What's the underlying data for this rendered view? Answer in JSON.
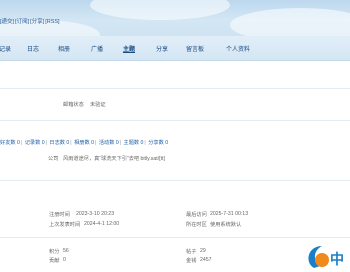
{
  "header": {
    "links": [
      "[递交]",
      "[订阅]",
      "[分享]",
      "[RSS]"
    ],
    "links_prefix": "递交"
  },
  "nav": {
    "items": [
      "记录",
      "日志",
      "相册",
      "广播",
      "主题",
      "分享",
      "留言板",
      "个人资料"
    ],
    "active_index": 4
  },
  "profile": {
    "email_status_label": "邮箱状态",
    "email_status_value": "未验证",
    "stats": [
      "好友数 0",
      "记录数 0",
      "日志数 0",
      "相册数 0",
      "活动数 0",
      "主题数 0",
      "分享数 0"
    ],
    "company_label": "公司",
    "company_value": "风雨道途尽，真“球洗天下引”去吧 bitly.sat/[tt]",
    "register_time_label": "注册时间",
    "register_time_value": "2023-3-10 20:23",
    "last_visit_label": "最后访问",
    "last_visit_value": "2025-7-31 00:13",
    "last_post_label": "上次发表时间",
    "last_post_value": "2024-4-1 12:00",
    "timezone_label": "所在时区",
    "timezone_value": "使用系统默认",
    "points_label": "积分",
    "points_value": "56",
    "posts_label": "帖子",
    "posts_value": "29",
    "contribution_label": "贡献",
    "contribution_value": "0",
    "gold_label": "金钱",
    "gold_value": "2457"
  },
  "watermark": {
    "text": "中"
  },
  "colors": {
    "link": "#1f5fa8",
    "nav": "#1a4a80",
    "banner": "#c9e0f2"
  }
}
